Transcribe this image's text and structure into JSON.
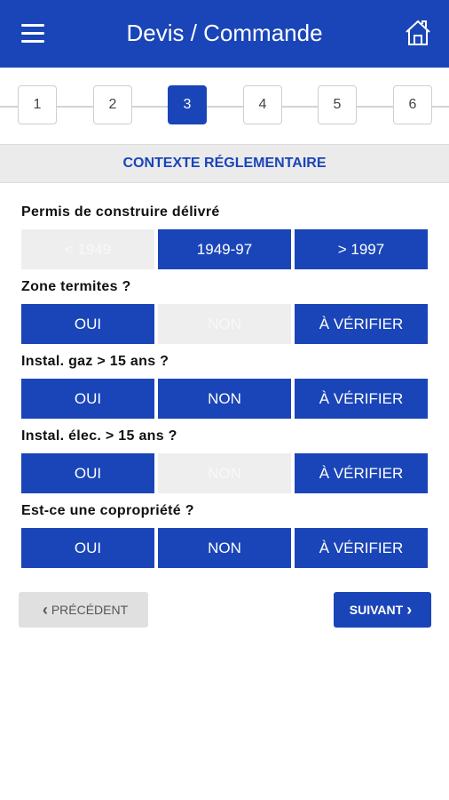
{
  "header": {
    "title": "Devis / Commande",
    "menu_icon": "hamburger-menu-icon",
    "home_icon": "home-icon"
  },
  "stepper": {
    "steps": [
      "1",
      "2",
      "3",
      "4",
      "5",
      "6"
    ],
    "active": "3"
  },
  "section": {
    "title": "CONTEXTE RÉGLEMENTAIRE"
  },
  "questions": [
    {
      "label": "Permis de construire délivré",
      "options": [
        "< 1949",
        "1949-97",
        "> 1997"
      ],
      "disabled": [
        "< 1949"
      ]
    },
    {
      "label": "Zone termites ?",
      "options": [
        "OUI",
        "NON",
        "À VÉRIFIER"
      ],
      "disabled": [
        "NON"
      ]
    },
    {
      "label": "Instal. gaz > 15 ans ?",
      "options": [
        "OUI",
        "NON",
        "À VÉRIFIER"
      ],
      "disabled": []
    },
    {
      "label": "Instal. élec. > 15 ans ?",
      "options": [
        "OUI",
        "NON",
        "À VÉRIFIER"
      ],
      "disabled": [
        "NON"
      ]
    },
    {
      "label": "Est-ce une copropriété ?",
      "options": [
        "OUI",
        "NON",
        "À VÉRIFIER"
      ],
      "disabled": []
    }
  ],
  "nav": {
    "prev_label": "PRÉCÉDENT",
    "next_label": "SUIVANT"
  },
  "colors": {
    "primary": "#1a45b8",
    "disabled_bg": "#eeeeee",
    "header_bg": "#ebebeb"
  }
}
